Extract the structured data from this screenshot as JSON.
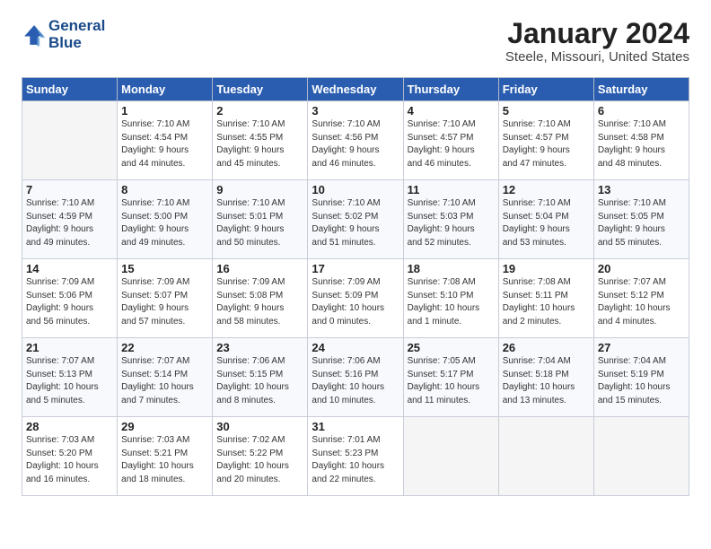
{
  "header": {
    "logo_line1": "General",
    "logo_line2": "Blue",
    "month": "January 2024",
    "location": "Steele, Missouri, United States"
  },
  "days_of_week": [
    "Sunday",
    "Monday",
    "Tuesday",
    "Wednesday",
    "Thursday",
    "Friday",
    "Saturday"
  ],
  "weeks": [
    [
      {
        "day": "",
        "sunrise": "",
        "sunset": "",
        "daylight": ""
      },
      {
        "day": "1",
        "sunrise": "Sunrise: 7:10 AM",
        "sunset": "Sunset: 4:54 PM",
        "daylight": "Daylight: 9 hours and 44 minutes."
      },
      {
        "day": "2",
        "sunrise": "Sunrise: 7:10 AM",
        "sunset": "Sunset: 4:55 PM",
        "daylight": "Daylight: 9 hours and 45 minutes."
      },
      {
        "day": "3",
        "sunrise": "Sunrise: 7:10 AM",
        "sunset": "Sunset: 4:56 PM",
        "daylight": "Daylight: 9 hours and 46 minutes."
      },
      {
        "day": "4",
        "sunrise": "Sunrise: 7:10 AM",
        "sunset": "Sunset: 4:57 PM",
        "daylight": "Daylight: 9 hours and 46 minutes."
      },
      {
        "day": "5",
        "sunrise": "Sunrise: 7:10 AM",
        "sunset": "Sunset: 4:57 PM",
        "daylight": "Daylight: 9 hours and 47 minutes."
      },
      {
        "day": "6",
        "sunrise": "Sunrise: 7:10 AM",
        "sunset": "Sunset: 4:58 PM",
        "daylight": "Daylight: 9 hours and 48 minutes."
      }
    ],
    [
      {
        "day": "7",
        "sunrise": "Sunrise: 7:10 AM",
        "sunset": "Sunset: 4:59 PM",
        "daylight": "Daylight: 9 hours and 49 minutes."
      },
      {
        "day": "8",
        "sunrise": "Sunrise: 7:10 AM",
        "sunset": "Sunset: 5:00 PM",
        "daylight": "Daylight: 9 hours and 49 minutes."
      },
      {
        "day": "9",
        "sunrise": "Sunrise: 7:10 AM",
        "sunset": "Sunset: 5:01 PM",
        "daylight": "Daylight: 9 hours and 50 minutes."
      },
      {
        "day": "10",
        "sunrise": "Sunrise: 7:10 AM",
        "sunset": "Sunset: 5:02 PM",
        "daylight": "Daylight: 9 hours and 51 minutes."
      },
      {
        "day": "11",
        "sunrise": "Sunrise: 7:10 AM",
        "sunset": "Sunset: 5:03 PM",
        "daylight": "Daylight: 9 hours and 52 minutes."
      },
      {
        "day": "12",
        "sunrise": "Sunrise: 7:10 AM",
        "sunset": "Sunset: 5:04 PM",
        "daylight": "Daylight: 9 hours and 53 minutes."
      },
      {
        "day": "13",
        "sunrise": "Sunrise: 7:10 AM",
        "sunset": "Sunset: 5:05 PM",
        "daylight": "Daylight: 9 hours and 55 minutes."
      }
    ],
    [
      {
        "day": "14",
        "sunrise": "Sunrise: 7:09 AM",
        "sunset": "Sunset: 5:06 PM",
        "daylight": "Daylight: 9 hours and 56 minutes."
      },
      {
        "day": "15",
        "sunrise": "Sunrise: 7:09 AM",
        "sunset": "Sunset: 5:07 PM",
        "daylight": "Daylight: 9 hours and 57 minutes."
      },
      {
        "day": "16",
        "sunrise": "Sunrise: 7:09 AM",
        "sunset": "Sunset: 5:08 PM",
        "daylight": "Daylight: 9 hours and 58 minutes."
      },
      {
        "day": "17",
        "sunrise": "Sunrise: 7:09 AM",
        "sunset": "Sunset: 5:09 PM",
        "daylight": "Daylight: 10 hours and 0 minutes."
      },
      {
        "day": "18",
        "sunrise": "Sunrise: 7:08 AM",
        "sunset": "Sunset: 5:10 PM",
        "daylight": "Daylight: 10 hours and 1 minute."
      },
      {
        "day": "19",
        "sunrise": "Sunrise: 7:08 AM",
        "sunset": "Sunset: 5:11 PM",
        "daylight": "Daylight: 10 hours and 2 minutes."
      },
      {
        "day": "20",
        "sunrise": "Sunrise: 7:07 AM",
        "sunset": "Sunset: 5:12 PM",
        "daylight": "Daylight: 10 hours and 4 minutes."
      }
    ],
    [
      {
        "day": "21",
        "sunrise": "Sunrise: 7:07 AM",
        "sunset": "Sunset: 5:13 PM",
        "daylight": "Daylight: 10 hours and 5 minutes."
      },
      {
        "day": "22",
        "sunrise": "Sunrise: 7:07 AM",
        "sunset": "Sunset: 5:14 PM",
        "daylight": "Daylight: 10 hours and 7 minutes."
      },
      {
        "day": "23",
        "sunrise": "Sunrise: 7:06 AM",
        "sunset": "Sunset: 5:15 PM",
        "daylight": "Daylight: 10 hours and 8 minutes."
      },
      {
        "day": "24",
        "sunrise": "Sunrise: 7:06 AM",
        "sunset": "Sunset: 5:16 PM",
        "daylight": "Daylight: 10 hours and 10 minutes."
      },
      {
        "day": "25",
        "sunrise": "Sunrise: 7:05 AM",
        "sunset": "Sunset: 5:17 PM",
        "daylight": "Daylight: 10 hours and 11 minutes."
      },
      {
        "day": "26",
        "sunrise": "Sunrise: 7:04 AM",
        "sunset": "Sunset: 5:18 PM",
        "daylight": "Daylight: 10 hours and 13 minutes."
      },
      {
        "day": "27",
        "sunrise": "Sunrise: 7:04 AM",
        "sunset": "Sunset: 5:19 PM",
        "daylight": "Daylight: 10 hours and 15 minutes."
      }
    ],
    [
      {
        "day": "28",
        "sunrise": "Sunrise: 7:03 AM",
        "sunset": "Sunset: 5:20 PM",
        "daylight": "Daylight: 10 hours and 16 minutes."
      },
      {
        "day": "29",
        "sunrise": "Sunrise: 7:03 AM",
        "sunset": "Sunset: 5:21 PM",
        "daylight": "Daylight: 10 hours and 18 minutes."
      },
      {
        "day": "30",
        "sunrise": "Sunrise: 7:02 AM",
        "sunset": "Sunset: 5:22 PM",
        "daylight": "Daylight: 10 hours and 20 minutes."
      },
      {
        "day": "31",
        "sunrise": "Sunrise: 7:01 AM",
        "sunset": "Sunset: 5:23 PM",
        "daylight": "Daylight: 10 hours and 22 minutes."
      },
      {
        "day": "",
        "sunrise": "",
        "sunset": "",
        "daylight": ""
      },
      {
        "day": "",
        "sunrise": "",
        "sunset": "",
        "daylight": ""
      },
      {
        "day": "",
        "sunrise": "",
        "sunset": "",
        "daylight": ""
      }
    ]
  ]
}
